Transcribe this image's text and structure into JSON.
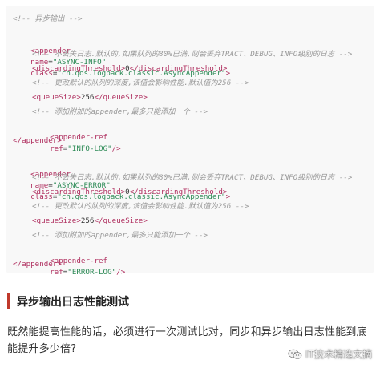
{
  "code": {
    "l1": "<!-- 异步输出 -->",
    "l2": {
      "open": "<appender",
      "a1": "name",
      "v1": "\"ASYNC-INFO\"",
      "a2": "class",
      "v2": "\"ch.qos.logback.classic.AsyncAppender\"",
      "close": ">"
    },
    "l3": "<!-- 不丢失日志.默认的,如果队列的80%已满,则会丢弃TRACT、DEBUG、INFO级别的日志 -->",
    "l4": {
      "open": "<discardingThreshold>",
      "val": "0",
      "close": "</discardingThreshold>"
    },
    "l5": "<!-- 更改默认的队列的深度,该值会影响性能.默认值为256 -->",
    "l6": {
      "open": "<queueSize>",
      "val": "256",
      "close": "</queueSize>"
    },
    "l7": "<!-- 添加附加的appender,最多只能添加一个 -->",
    "l8": {
      "open": "<appender-ref",
      "a1": "ref",
      "v1": "\"INFO-LOG\"",
      "close": "/>"
    },
    "l9": "</appender>",
    "l10": {
      "open": "<appender",
      "a1": "name",
      "v1": "\"ASYNC-ERROR\"",
      "a2": "class",
      "v2": "\"ch.qos.logback.classic.AsyncAppender\"",
      "close": ">"
    },
    "l11": "<!-- 不丢失日志.默认的,如果队列的80%已满,则会丢弃TRACT、DEBUG、INFO级别的日志 -->",
    "l12": {
      "open": "<discardingThreshold>",
      "val": "0",
      "close": "</discardingThreshold>"
    },
    "l13": "<!-- 更改默认的队列的深度,该值会影响性能.默认值为256 -->",
    "l14": {
      "open": "<queueSize>",
      "val": "256",
      "close": "</queueSize>"
    },
    "l15": "<!-- 添加附加的appender,最多只能添加一个 -->",
    "l16": {
      "open": "<appender-ref",
      "a1": "ref",
      "v1": "\"ERROR-LOG\"",
      "close": "/>"
    },
    "l17": "</appender>"
  },
  "heading": "异步输出日志性能测试",
  "paragraph": "既然能提高性能的话，必须进行一次测试比对，同步和异步输出日志性能到底能提升多少倍?",
  "watermark": "IT技术精选文摘",
  "colors": {
    "accent": "#c0392b",
    "tag": "#b03060",
    "string": "#2e8b57",
    "comment": "#999999"
  }
}
